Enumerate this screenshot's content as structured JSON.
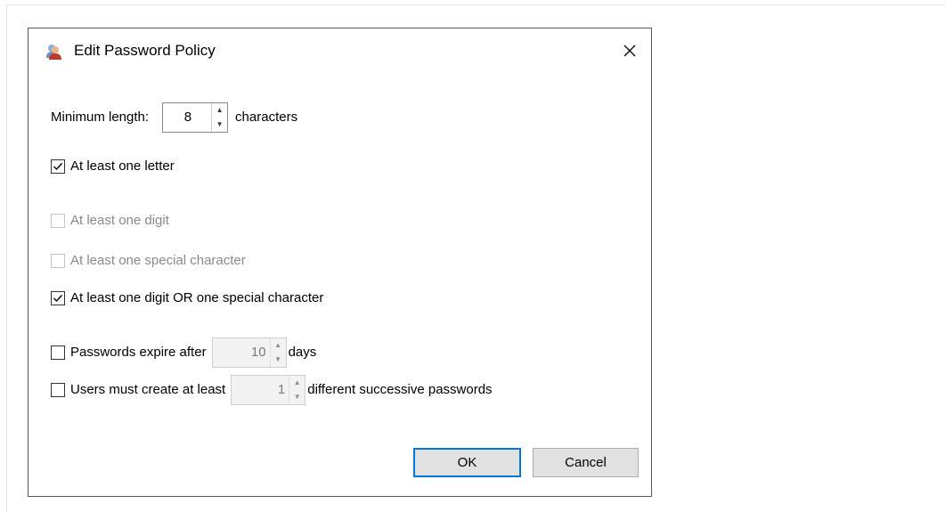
{
  "dialog": {
    "title": "Edit Password Policy",
    "title_icon": "users-icon",
    "close_icon": "close-icon"
  },
  "min_length": {
    "label": "Minimum length:",
    "value": "8",
    "suffix": "characters"
  },
  "options": {
    "letter": {
      "label": "At least one letter",
      "checked": true,
      "enabled": true
    },
    "digit": {
      "label": "At least one digit",
      "checked": false,
      "enabled": false
    },
    "special": {
      "label": "At least one special character",
      "checked": false,
      "enabled": false
    },
    "digit_or_special": {
      "label": "At least one digit OR one special character",
      "checked": true,
      "enabled": true
    }
  },
  "expire": {
    "label": "Passwords expire after",
    "value": "10",
    "suffix": "days",
    "checked": false
  },
  "successive": {
    "label": "Users must create at least",
    "value": "1",
    "suffix": "different successive passwords",
    "checked": false
  },
  "buttons": {
    "ok": "OK",
    "cancel": "Cancel"
  },
  "colors": {
    "accent": "#0078d7",
    "disabled_text": "#8a8a8a"
  }
}
